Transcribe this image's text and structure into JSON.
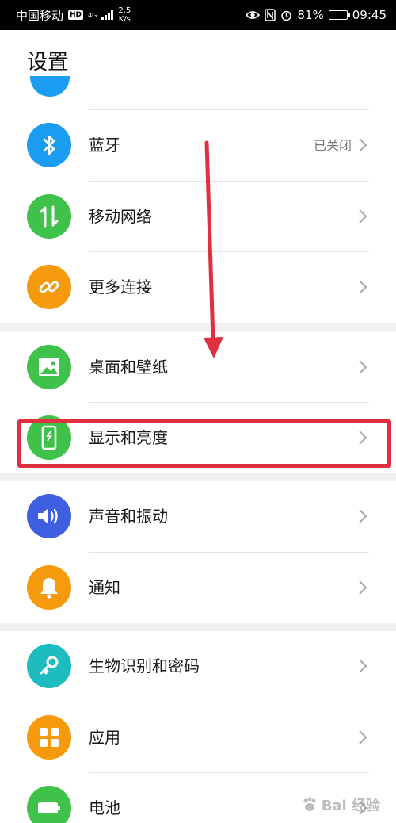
{
  "status_bar": {
    "carrier": "中国移动",
    "hd": "HD",
    "net_type": "4G",
    "speed_value": "2.5",
    "speed_unit": "K/s",
    "battery_percent": "81%",
    "battery_level": 0.81,
    "time": "09:45"
  },
  "page": {
    "title": "设置"
  },
  "items": [
    {
      "label": "蓝牙",
      "value": "已关闭",
      "icon": "bluetooth-icon",
      "color": "#1a9cf0"
    },
    {
      "label": "移动网络",
      "icon": "mobile-data-icon",
      "color": "#3fc24a"
    },
    {
      "label": "更多连接",
      "icon": "link-icon",
      "color": "#f59a0d"
    },
    {
      "label": "桌面和壁纸",
      "icon": "image-icon",
      "color": "#3fc24a"
    },
    {
      "label": "显示和亮度",
      "icon": "display-icon",
      "color": "#3fc24a"
    },
    {
      "label": "声音和振动",
      "icon": "speaker-icon",
      "color": "#3d5fe0"
    },
    {
      "label": "通知",
      "icon": "bell-icon",
      "color": "#f59a0d"
    },
    {
      "label": "生物识别和密码",
      "icon": "key-icon",
      "color": "#1cbcbf"
    },
    {
      "label": "应用",
      "icon": "apps-grid-icon",
      "color": "#f59a0d"
    },
    {
      "label": "电池",
      "icon": "battery-icon",
      "color": "#3fc24a"
    }
  ],
  "annotation": {
    "color": "#e0303f"
  },
  "watermark": {
    "text": "Bai 经验"
  }
}
